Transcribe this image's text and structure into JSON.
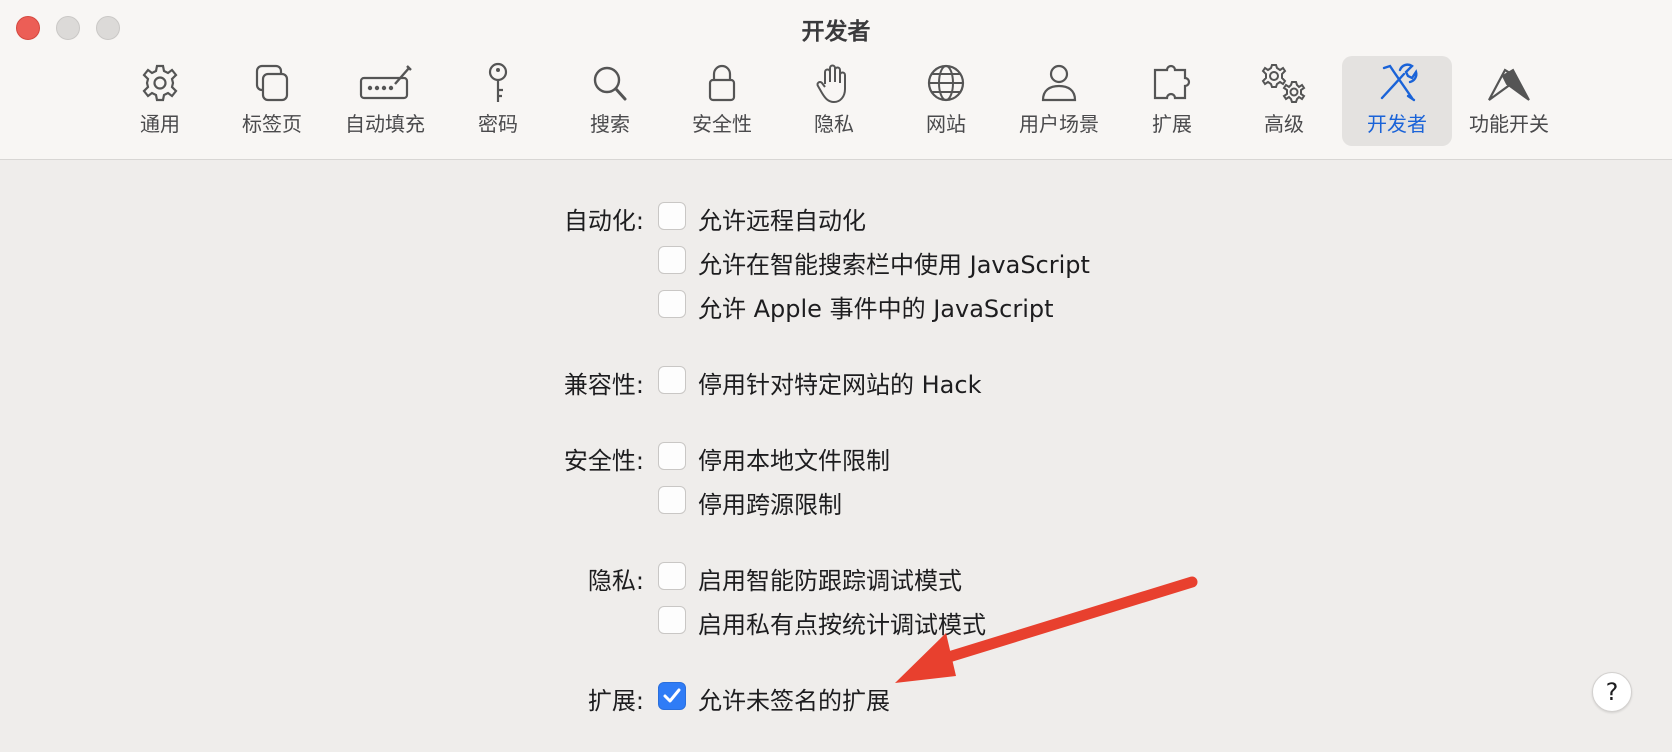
{
  "window": {
    "title": "开发者"
  },
  "tabs": [
    {
      "label": "通用",
      "icon": "gear-icon"
    },
    {
      "label": "标签页",
      "icon": "tabs-icon"
    },
    {
      "label": "自动填充",
      "icon": "autofill-icon"
    },
    {
      "label": "密码",
      "icon": "key-icon"
    },
    {
      "label": "搜索",
      "icon": "search-icon"
    },
    {
      "label": "安全性",
      "icon": "lock-icon"
    },
    {
      "label": "隐私",
      "icon": "hand-icon"
    },
    {
      "label": "网站",
      "icon": "globe-icon"
    },
    {
      "label": "用户场景",
      "icon": "person-icon"
    },
    {
      "label": "扩展",
      "icon": "puzzle-icon"
    },
    {
      "label": "高级",
      "icon": "gears-icon"
    },
    {
      "label": "开发者",
      "icon": "tools-icon",
      "selected": true
    },
    {
      "label": "功能开关",
      "icon": "flags-icon"
    }
  ],
  "sections": {
    "automation": {
      "label": "自动化:",
      "options": [
        {
          "text": "允许远程自动化",
          "checked": false
        },
        {
          "text": "允许在智能搜索栏中使用 JavaScript",
          "checked": false
        },
        {
          "text": "允许 Apple 事件中的 JavaScript",
          "checked": false
        }
      ]
    },
    "compat": {
      "label": "兼容性:",
      "options": [
        {
          "text": "停用针对特定网站的 Hack",
          "checked": false
        }
      ]
    },
    "security": {
      "label": "安全性:",
      "options": [
        {
          "text": "停用本地文件限制",
          "checked": false
        },
        {
          "text": "停用跨源限制",
          "checked": false
        }
      ]
    },
    "privacy": {
      "label": "隐私:",
      "options": [
        {
          "text": "启用智能防跟踪调试模式",
          "checked": false
        },
        {
          "text": "启用私有点按统计调试模式",
          "checked": false
        }
      ]
    },
    "extensions": {
      "label": "扩展:",
      "options": [
        {
          "text": "允许未签名的扩展",
          "checked": true
        }
      ]
    }
  },
  "help": {
    "label": "?"
  },
  "colors": {
    "accent": "#2f7cf6",
    "arrow": "#e8402e",
    "selected_tab_text": "#1a63d8"
  }
}
